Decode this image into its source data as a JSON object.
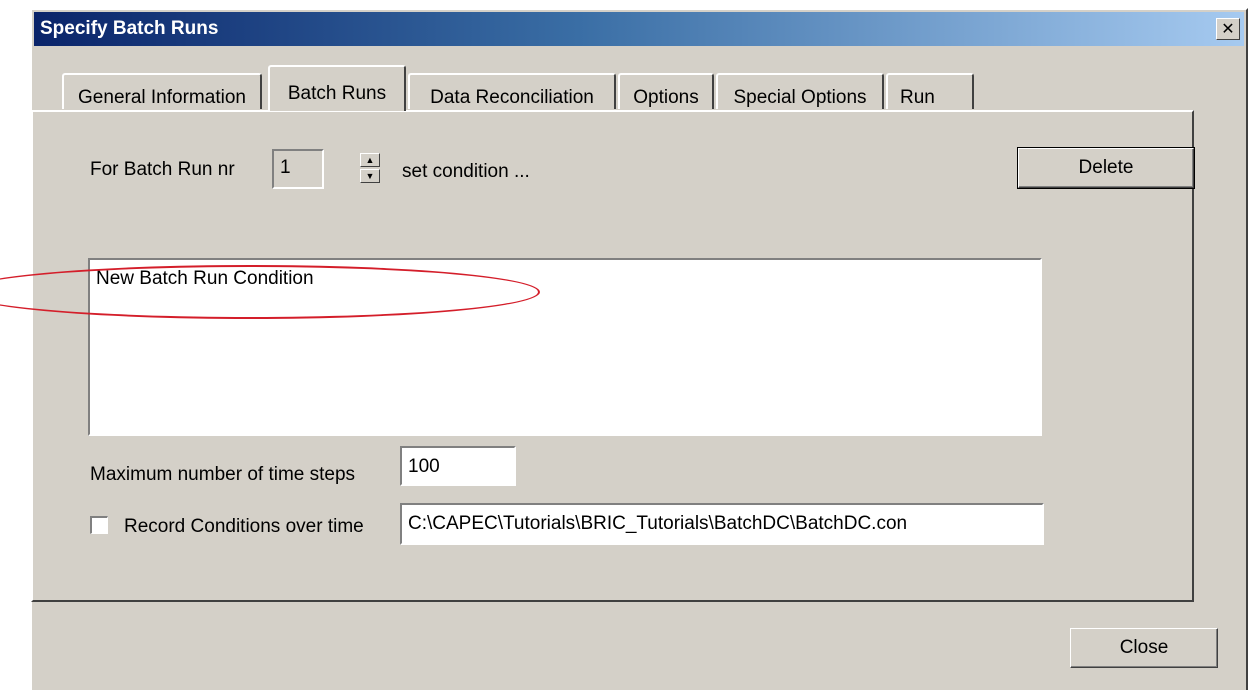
{
  "window": {
    "title": "Specify Batch Runs",
    "close_glyph": "✕"
  },
  "tabs": [
    {
      "label": "General Information"
    },
    {
      "label": "Batch Runs"
    },
    {
      "label": "Data Reconciliation"
    },
    {
      "label": "Options"
    },
    {
      "label": "Special Options"
    },
    {
      "label": "Run"
    }
  ],
  "batch": {
    "for_label": "For Batch Run nr",
    "run_number": "1",
    "set_condition_label": "set condition ...",
    "delete_label": "Delete",
    "conditions_text": "New Batch Run Condition",
    "max_steps_label": "Maximum number of time steps",
    "max_steps_value": "100",
    "record_label": "Record Conditions over time",
    "record_checked": false,
    "record_path": "C:\\CAPEC\\Tutorials\\BRIC_Tutorials\\BatchDC\\BatchDC.con"
  },
  "footer": {
    "close_label": "Close"
  },
  "annotation": {
    "color": "#d41e2a"
  }
}
